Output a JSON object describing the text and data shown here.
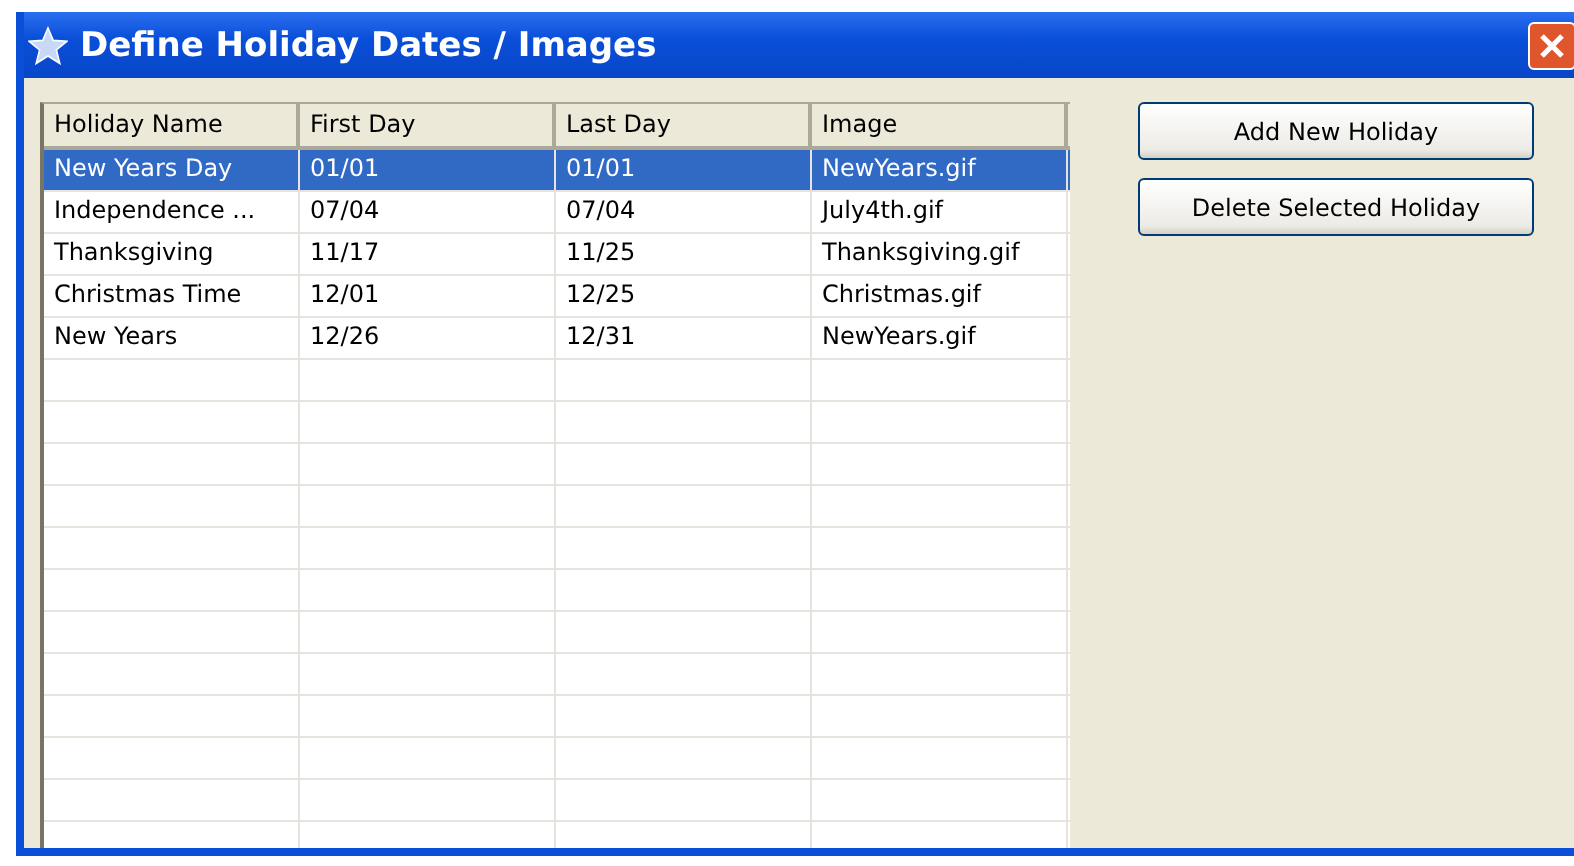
{
  "window": {
    "title": "Define Holiday Dates / Images"
  },
  "table": {
    "columns": [
      "Holiday Name",
      "First Day",
      "Last Day",
      "Image"
    ],
    "rows": [
      {
        "cells": [
          "New Years Day",
          "01/01",
          "01/01",
          "NewYears.gif"
        ],
        "selected": true
      },
      {
        "cells": [
          "Independence ...",
          "07/04",
          "07/04",
          "July4th.gif"
        ],
        "selected": false
      },
      {
        "cells": [
          "Thanksgiving",
          "11/17",
          "11/25",
          "Thanksgiving.gif"
        ],
        "selected": false
      },
      {
        "cells": [
          "Christmas Time",
          "12/01",
          "12/25",
          "Christmas.gif"
        ],
        "selected": false
      },
      {
        "cells": [
          "New Years",
          "12/26",
          "12/31",
          "NewYears.gif"
        ],
        "selected": false
      }
    ]
  },
  "buttons": [
    "Add New Holiday",
    "Delete Selected Holiday"
  ]
}
